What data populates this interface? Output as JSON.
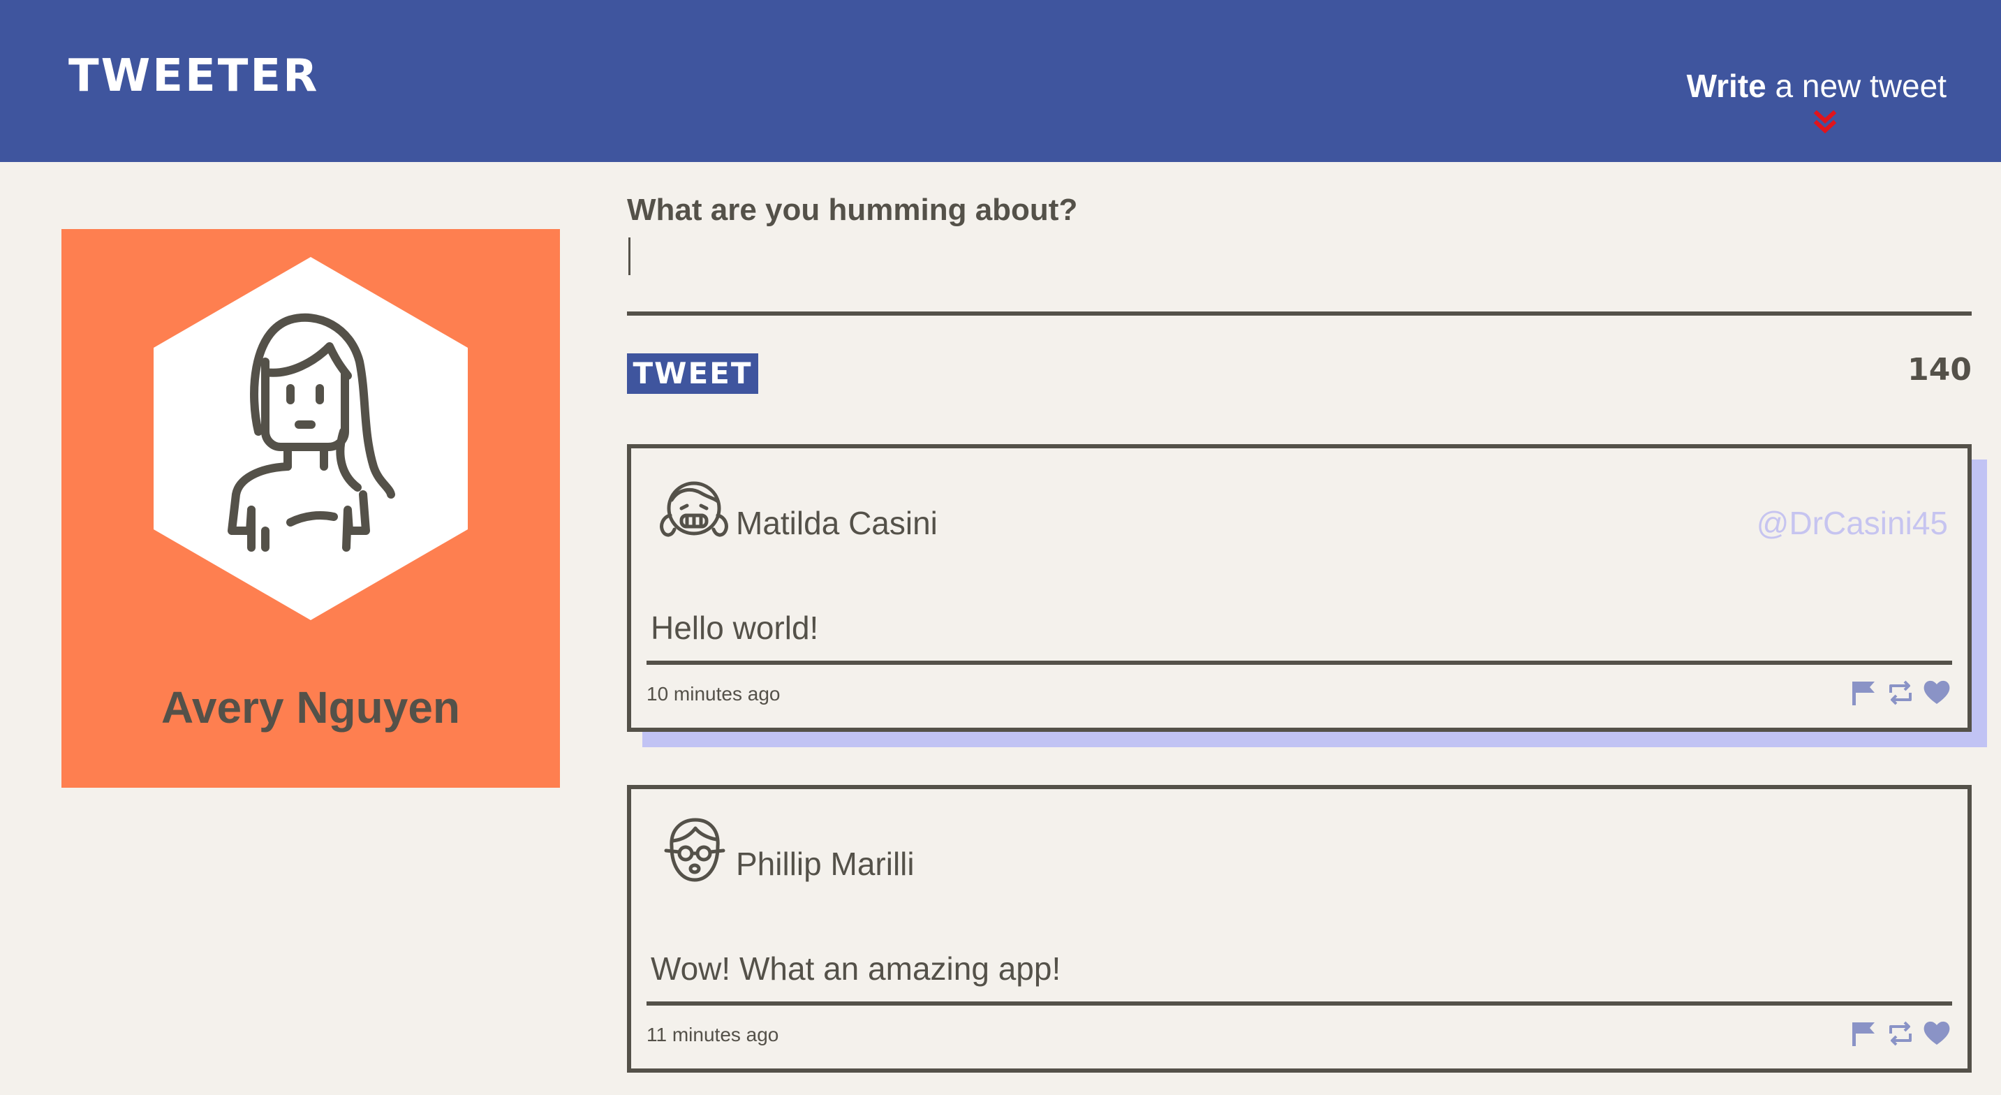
{
  "nav": {
    "brand": "TWEETER",
    "compose_bold": "Write",
    "compose_rest": " a new tweet"
  },
  "profile": {
    "name": "Avery Nguyen"
  },
  "composer": {
    "label": "What are you humming about?",
    "value": "",
    "button_label": "TWEET",
    "counter": "140"
  },
  "tweets": [
    {
      "name": "Matilda Casini",
      "handle": "@DrCasini45",
      "content": "Hello world!",
      "time": "10 minutes ago"
    },
    {
      "name": "Phillip Marilli",
      "handle": "",
      "content": "Wow! What an amazing app!",
      "time": "11 minutes ago"
    }
  ],
  "icons": {
    "compose": "double-chevron-down-icon",
    "actions": [
      "flag-icon",
      "retweet-icon",
      "heart-icon"
    ]
  },
  "colors": {
    "nav": "#3f559e",
    "background": "#f4f1ec",
    "profile": "#fe7f50",
    "text": "#545149",
    "handle": "#c6c4f0",
    "shadow": "#c1c3f4",
    "action_icons": "#8a93c6",
    "chevron": "#e0141c"
  }
}
